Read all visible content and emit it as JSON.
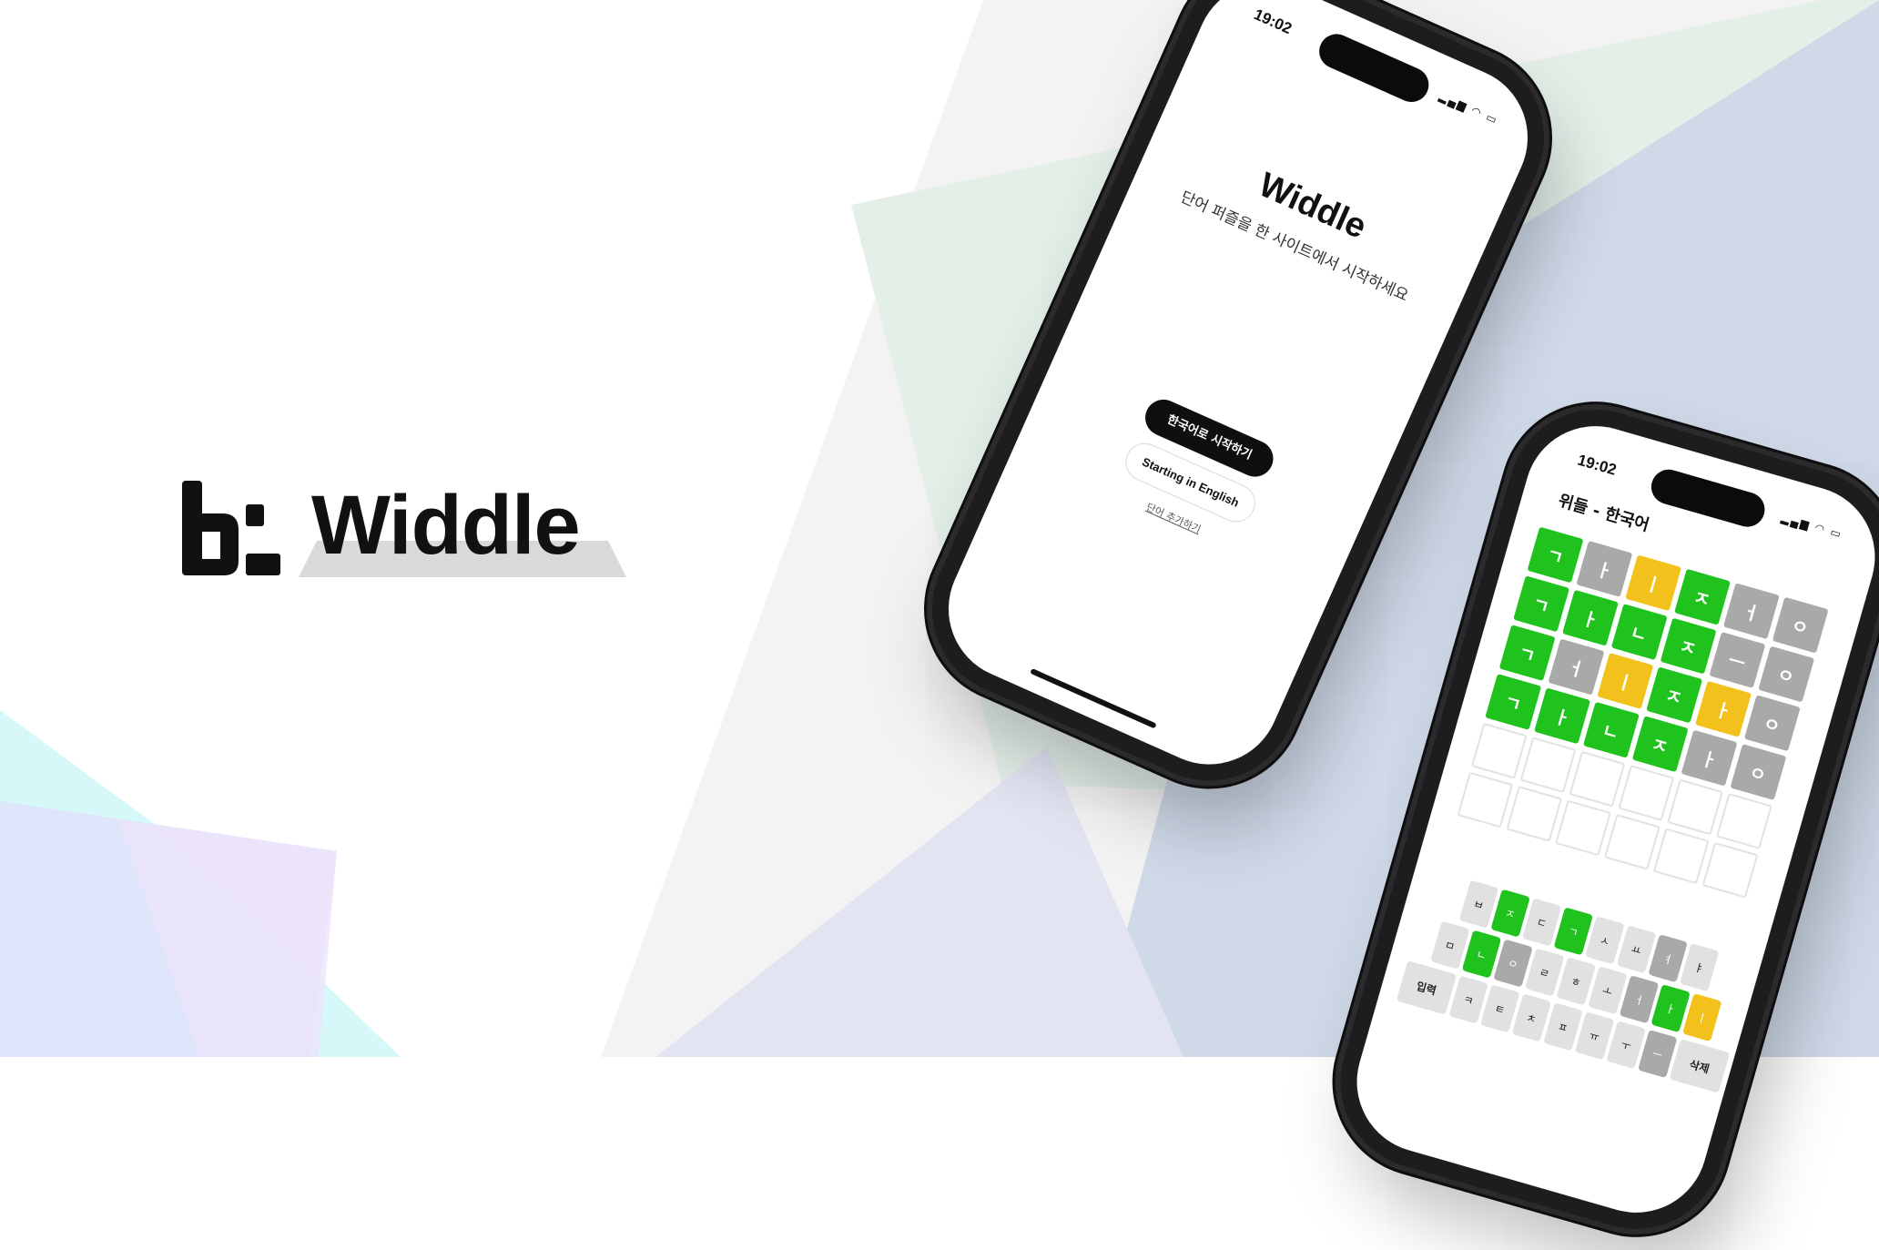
{
  "brand": {
    "name": "Widdle"
  },
  "colors": {
    "correct": "#20c31d",
    "present": "#f3c11b",
    "absent": "#a9a9a9",
    "frame": "#1d1d1f"
  },
  "phone1": {
    "status_time": "19:02",
    "title": "Widdle",
    "subtitle": "단어 퍼즐을 한 사이트에서 시작하세요",
    "buttons": {
      "korean": "한국어로 시작하기",
      "english": "Starting in English",
      "add_word": "단어 추가하기"
    }
  },
  "phone2": {
    "status_time": "19:02",
    "title": "위들 - 한국어",
    "grid": [
      [
        [
          "ㄱ",
          "g"
        ],
        [
          "ㅏ",
          "x"
        ],
        [
          "ㅣ",
          "y"
        ],
        [
          "ㅈ",
          "g"
        ],
        [
          "ㅓ",
          "x"
        ],
        [
          "ㅇ",
          "x"
        ]
      ],
      [
        [
          "ㄱ",
          "g"
        ],
        [
          "ㅏ",
          "g"
        ],
        [
          "ㄴ",
          "g"
        ],
        [
          "ㅈ",
          "g"
        ],
        [
          "ㅡ",
          "x"
        ],
        [
          "ㅇ",
          "x"
        ]
      ],
      [
        [
          "ㄱ",
          "g"
        ],
        [
          "ㅓ",
          "x"
        ],
        [
          "ㅣ",
          "y"
        ],
        [
          "ㅈ",
          "g"
        ],
        [
          "ㅏ",
          "y"
        ],
        [
          "ㅇ",
          "x"
        ]
      ],
      [
        [
          "ㄱ",
          "g"
        ],
        [
          "ㅏ",
          "g"
        ],
        [
          "ㄴ",
          "g"
        ],
        [
          "ㅈ",
          "g"
        ],
        [
          "ㅏ",
          "x"
        ],
        [
          "ㅇ",
          "x"
        ]
      ],
      [
        [
          "",
          ""
        ],
        [
          "",
          ""
        ],
        [
          "",
          ""
        ],
        [
          "",
          ""
        ],
        [
          "",
          ""
        ],
        [
          "",
          ""
        ]
      ],
      [
        [
          "",
          ""
        ],
        [
          "",
          ""
        ],
        [
          "",
          ""
        ],
        [
          "",
          ""
        ],
        [
          "",
          ""
        ],
        [
          "",
          ""
        ]
      ]
    ],
    "keyboard": [
      [
        [
          "ㅂ",
          ""
        ],
        [
          "ㅈ",
          "g"
        ],
        [
          "ㄷ",
          ""
        ],
        [
          "ㄱ",
          "g"
        ],
        [
          "ㅅ",
          ""
        ],
        [
          "ㅛ",
          ""
        ],
        [
          "ㅕ",
          "x"
        ],
        [
          "ㅑ",
          ""
        ]
      ],
      [
        [
          "ㅁ",
          ""
        ],
        [
          "ㄴ",
          "g"
        ],
        [
          "ㅇ",
          "x"
        ],
        [
          "ㄹ",
          ""
        ],
        [
          "ㅎ",
          ""
        ],
        [
          "ㅗ",
          ""
        ],
        [
          "ㅓ",
          "x"
        ],
        [
          "ㅏ",
          "g"
        ],
        [
          "ㅣ",
          "y"
        ]
      ],
      [
        [
          "입력",
          "wide"
        ],
        [
          "ㅋ",
          ""
        ],
        [
          "ㅌ",
          ""
        ],
        [
          "ㅊ",
          ""
        ],
        [
          "ㅍ",
          ""
        ],
        [
          "ㅠ",
          ""
        ],
        [
          "ㅜ",
          ""
        ],
        [
          "ㅡ",
          "x"
        ],
        [
          "삭제",
          "wide"
        ]
      ]
    ]
  }
}
